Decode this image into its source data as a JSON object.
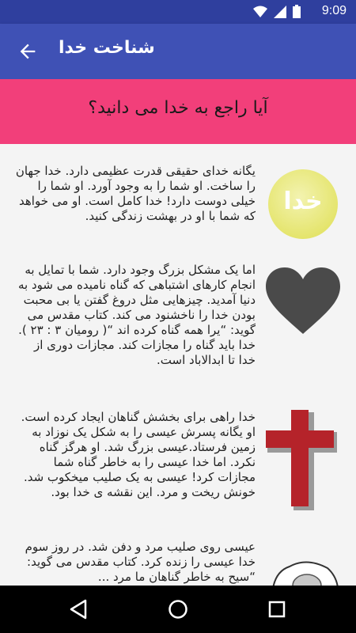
{
  "status_bar": {
    "time": "9:09",
    "icons": [
      "wifi-icon",
      "signal-icon",
      "battery-icon"
    ]
  },
  "app_bar": {
    "title": "شناخت خدا",
    "back_icon": "arrow-back-icon"
  },
  "banner": {
    "question": "آیا راجع به خدا می دانید؟"
  },
  "sections": [
    {
      "icon": "khoda-circle-icon",
      "icon_label": "خدا",
      "text": "یگانه خدای حقیقی قدرت عظیمی دارد. خدا جهان را ساخت. او شما را به وجود آورد. او شما را خیلی دوست دارد! خدا کامل است. او می خواهد که شما با او در بهشت زندگی کنید."
    },
    {
      "icon": "heart-icon",
      "text": "اما یک مشکل بزرگ وجود دارد. شما با تمایل به انجام کارهای اشتباهی که گناه نامیده می شود به دنیا آمدید. چیزهایی مثل دروغ گفتن یا بی محبت بودن خدا را ناخشنود می کند. کتاب مقدس می گوید: “یرا همه گناه کرده اند “( رومیان ۳ : ۲۳ ). خدا باید گناه را مجازات کند. مجازات دوری از خدا تا ابدالاباد است."
    },
    {
      "icon": "cross-icon",
      "text": "خدا راهی برای بخشش گناهان ایجاد کرده است. او یگانه پسرش عیسی را به شکل یک نوزاد به زمین فرستاد.عیسی بزرگ شد. او هرگز گناه نکرد. اما خدا عیسی را به خاطر گناه شما مجازات کرد! عیسی به یک صلیب میخکوب شد. خونش ریخت و مرد. این نقشه ی خدا بود."
    },
    {
      "icon": "tomb-stone-icon",
      "text": "عیسی روی صلیب مرد و دفن شد. در روز سوم خدا عیسی را زنده کرد. کتاب مقدس می گوید: “سیح به خاطر گناهان ما مرد ..."
    }
  ],
  "nav_bar": {
    "buttons": [
      "back-triangle-icon",
      "home-circle-icon",
      "recents-square-icon"
    ]
  },
  "colors": {
    "status_bar": "#2f3f9e",
    "app_bar": "#3f51b5",
    "banner": "#f23f7a",
    "heart": "#4a4a4a",
    "cross": "#b5232a"
  }
}
